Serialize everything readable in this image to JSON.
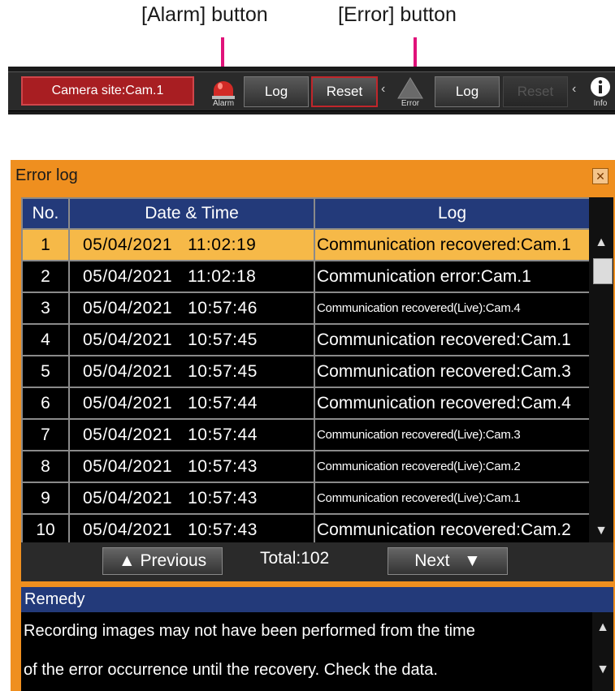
{
  "callouts": {
    "alarm": "[Alarm] button",
    "error": "[Error] button"
  },
  "toolbar": {
    "camera_site": "Camera site:Cam.1",
    "alarm_label": "Alarm",
    "alarm_log": "Log",
    "alarm_reset": "Reset",
    "error_label": "Error",
    "error_log": "Log",
    "error_reset": "Reset",
    "info_label": "Info",
    "chevron": "‹"
  },
  "error_log": {
    "title": "Error log",
    "columns": [
      "No.",
      "Date & Time",
      "Log"
    ],
    "selected_row": 1,
    "rows": [
      {
        "no": "1",
        "date": "05/04/2021",
        "time": "11:02:19",
        "log": "Communication recovered:Cam.1"
      },
      {
        "no": "2",
        "date": "05/04/2021",
        "time": "11:02:18",
        "log": "Communication error:Cam.1"
      },
      {
        "no": "3",
        "date": "05/04/2021",
        "time": "10:57:46",
        "log": "Communication recovered(Live):Cam.4"
      },
      {
        "no": "4",
        "date": "05/04/2021",
        "time": "10:57:45",
        "log": "Communication recovered:Cam.1"
      },
      {
        "no": "5",
        "date": "05/04/2021",
        "time": "10:57:45",
        "log": "Communication recovered:Cam.3"
      },
      {
        "no": "6",
        "date": "05/04/2021",
        "time": "10:57:44",
        "log": "Communication recovered:Cam.4"
      },
      {
        "no": "7",
        "date": "05/04/2021",
        "time": "10:57:44",
        "log": "Communication recovered(Live):Cam.3"
      },
      {
        "no": "8",
        "date": "05/04/2021",
        "time": "10:57:43",
        "log": "Communication recovered(Live):Cam.2"
      },
      {
        "no": "9",
        "date": "05/04/2021",
        "time": "10:57:43",
        "log": "Communication recovered(Live):Cam.1"
      },
      {
        "no": "10",
        "date": "05/04/2021",
        "time": "10:57:43",
        "log": "Communication recovered:Cam.2"
      }
    ],
    "previous": "Previous",
    "next": "Next",
    "total": "Total:102"
  },
  "remedy": {
    "title": "Remedy",
    "line1": "Recording images may not have been performed from the time",
    "line2": "of the error occurrence until the recovery. Check the data."
  },
  "colors": {
    "dialog": "#ef8f1f",
    "header": "#233a7a",
    "selected": "#f6b948",
    "site": "#a81e22",
    "callout_line": "#e0127a"
  },
  "icons": [
    "alarm-lamp-icon",
    "error-triangle-icon",
    "info-icon",
    "close-icon",
    "scroll-up-icon",
    "scroll-down-icon",
    "triangle-up-icon",
    "triangle-down-icon"
  ]
}
